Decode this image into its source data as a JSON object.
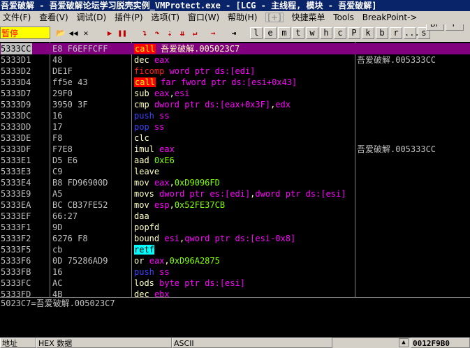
{
  "title": "吾爱破解 - 吾爱破解论坛学习脱壳实例_VMProtect.exe - [LCG - 主线程, 模块 - 吾爱破解]",
  "menu": [
    {
      "label": "文件(F)"
    },
    {
      "label": "查看(V)"
    },
    {
      "label": "调试(D)"
    },
    {
      "label": "插件(P)"
    },
    {
      "label": "选项(T)"
    },
    {
      "label": "窗口(W)"
    },
    {
      "label": "帮助(H)"
    },
    {
      "label": "[+]"
    },
    {
      "label": "快捷菜单"
    },
    {
      "label": "Tools"
    },
    {
      "label": "BreakPoint->"
    }
  ],
  "toolbar": {
    "state": "暂停",
    "letter_buttons": [
      "l",
      "e",
      "m",
      "t",
      "w",
      "h",
      "c",
      "P",
      "k",
      "b",
      "r",
      "...",
      "s"
    ],
    "bp_label": "BP",
    "p_label": "P"
  },
  "disasm_rows": [
    {
      "addr": "5333CC",
      "hex": "E8 F6EFFCFF",
      "tokens": [
        {
          "t": "call",
          "c": "k-call"
        },
        {
          "t": " 吾爱破解.005023C7",
          "c": "k-mov"
        }
      ],
      "comment": "",
      "sel": true
    },
    {
      "addr": "5333D1",
      "hex": "48",
      "tokens": [
        {
          "t": "dec ",
          "c": "k-mov"
        },
        {
          "t": "eax",
          "c": "t-reg"
        }
      ],
      "comment": "吾爱破解.005333CC",
      "sel": false
    },
    {
      "addr": "5333D2",
      "hex": "DE1F",
      "tokens": [
        {
          "t": "ficomp ",
          "c": "k-red"
        },
        {
          "t": "word ptr ds:[edi]",
          "c": "t-mem"
        }
      ],
      "comment": "",
      "sel": false
    },
    {
      "addr": "5333D4",
      "hex": "ff5e 43",
      "tokens": [
        {
          "t": "call",
          "c": "k-call"
        },
        {
          "t": " far fword ptr ds:[esi+0x43]",
          "c": "t-mem"
        }
      ],
      "comment": "",
      "sel": false
    },
    {
      "addr": "5333D7",
      "hex": "29F0",
      "tokens": [
        {
          "t": "sub ",
          "c": "k-mov"
        },
        {
          "t": "eax",
          "c": "t-reg"
        },
        {
          "t": ",",
          "c": "k-mov"
        },
        {
          "t": "esi",
          "c": "t-reg"
        }
      ],
      "comment": "",
      "sel": false
    },
    {
      "addr": "5333D9",
      "hex": "3950 3F",
      "tokens": [
        {
          "t": "cmp ",
          "c": "k-mov"
        },
        {
          "t": "dword ptr ds:[eax+0x3F]",
          "c": "t-mem"
        },
        {
          "t": ",",
          "c": "k-mov"
        },
        {
          "t": "edx",
          "c": "t-reg"
        }
      ],
      "comment": "",
      "sel": false
    },
    {
      "addr": "5333DC",
      "hex": "16",
      "tokens": [
        {
          "t": "push ",
          "c": "k-blue"
        },
        {
          "t": "ss",
          "c": "t-reg"
        }
      ],
      "comment": "",
      "sel": false
    },
    {
      "addr": "5333DD",
      "hex": "17",
      "tokens": [
        {
          "t": "pop ",
          "c": "k-blue"
        },
        {
          "t": "ss",
          "c": "t-reg"
        }
      ],
      "comment": "",
      "sel": false
    },
    {
      "addr": "5333DE",
      "hex": "F8",
      "tokens": [
        {
          "t": "clc",
          "c": "k-mov"
        }
      ],
      "comment": "",
      "sel": false
    },
    {
      "addr": "5333DF",
      "hex": "F7E8",
      "tokens": [
        {
          "t": "imul ",
          "c": "k-mov"
        },
        {
          "t": "eax",
          "c": "t-reg"
        }
      ],
      "comment": "吾爱破解.005333CC",
      "sel": false
    },
    {
      "addr": "5333E1",
      "hex": "D5 E6",
      "tokens": [
        {
          "t": "aad ",
          "c": "k-mov"
        },
        {
          "t": "0xE6",
          "c": "t-num"
        }
      ],
      "comment": "",
      "sel": false
    },
    {
      "addr": "5333E3",
      "hex": "C9",
      "tokens": [
        {
          "t": "leave",
          "c": "k-mov"
        }
      ],
      "comment": "",
      "sel": false
    },
    {
      "addr": "5333E4",
      "hex": "B8 FD96900D",
      "tokens": [
        {
          "t": "mov ",
          "c": "k-mov"
        },
        {
          "t": "eax",
          "c": "t-reg"
        },
        {
          "t": ",",
          "c": "k-mov"
        },
        {
          "t": "0xD9096FD",
          "c": "t-num"
        }
      ],
      "comment": "",
      "sel": false
    },
    {
      "addr": "5333E9",
      "hex": "A5",
      "tokens": [
        {
          "t": "movs ",
          "c": "k-mov"
        },
        {
          "t": "dword ptr es:[edi]",
          "c": "t-mem"
        },
        {
          "t": ",",
          "c": "k-mov"
        },
        {
          "t": "dword ptr ds:[esi]",
          "c": "t-mem"
        }
      ],
      "comment": "",
      "sel": false
    },
    {
      "addr": "5333EA",
      "hex": "BC CB37FE52",
      "tokens": [
        {
          "t": "mov ",
          "c": "k-mov"
        },
        {
          "t": "esp",
          "c": "t-reg"
        },
        {
          "t": ",",
          "c": "k-mov"
        },
        {
          "t": "0x52FE37CB",
          "c": "t-num"
        }
      ],
      "comment": "",
      "sel": false
    },
    {
      "addr": "5333EF",
      "hex": "66:27",
      "tokens": [
        {
          "t": "daa",
          "c": "k-mov"
        }
      ],
      "comment": "",
      "sel": false
    },
    {
      "addr": "5333F1",
      "hex": "9D",
      "tokens": [
        {
          "t": "popfd",
          "c": "k-mov"
        }
      ],
      "comment": "",
      "sel": false
    },
    {
      "addr": "5333F2",
      "hex": "6276 F8",
      "tokens": [
        {
          "t": "bound ",
          "c": "k-mov"
        },
        {
          "t": "esi",
          "c": "t-reg"
        },
        {
          "t": ",",
          "c": "k-mov"
        },
        {
          "t": "qword ptr ds:[esi-0x8]",
          "c": "t-mem"
        }
      ],
      "comment": "",
      "sel": false
    },
    {
      "addr": "5333F5",
      "hex": "cb",
      "tokens": [
        {
          "t": "retf",
          "c": "k-cyan"
        }
      ],
      "comment": "",
      "sel": false
    },
    {
      "addr": "5333F6",
      "hex": "0D 75286AD9",
      "tokens": [
        {
          "t": "or ",
          "c": "k-mov"
        },
        {
          "t": "eax",
          "c": "t-reg"
        },
        {
          "t": ",",
          "c": "k-mov"
        },
        {
          "t": "0xD96A2875",
          "c": "t-num"
        }
      ],
      "comment": "",
      "sel": false
    },
    {
      "addr": "5333FB",
      "hex": "16",
      "tokens": [
        {
          "t": "push ",
          "c": "k-blue"
        },
        {
          "t": "ss",
          "c": "t-reg"
        }
      ],
      "comment": "",
      "sel": false
    },
    {
      "addr": "5333FC",
      "hex": "AC",
      "tokens": [
        {
          "t": "lods ",
          "c": "k-mov"
        },
        {
          "t": "byte ptr ds:[esi]",
          "c": "t-mem"
        }
      ],
      "comment": "",
      "sel": false
    },
    {
      "addr": "5333FD",
      "hex": "4B",
      "tokens": [
        {
          "t": "dec ",
          "c": "k-mov"
        },
        {
          "t": "ebx",
          "c": "t-reg"
        }
      ],
      "comment": "",
      "sel": false
    }
  ],
  "info_line": "5023C7=吾爱破解.005023C7",
  "bottom": {
    "addr_label": "地址",
    "hex_label": "HEX 数据",
    "ascii_label": "ASCII",
    "stack_value": "0012F9B0"
  },
  "colors": {
    "title_bg": "#0a246a",
    "selection": "#800080",
    "state_bg": "#ffff00",
    "call_bg": "#ff0000"
  }
}
